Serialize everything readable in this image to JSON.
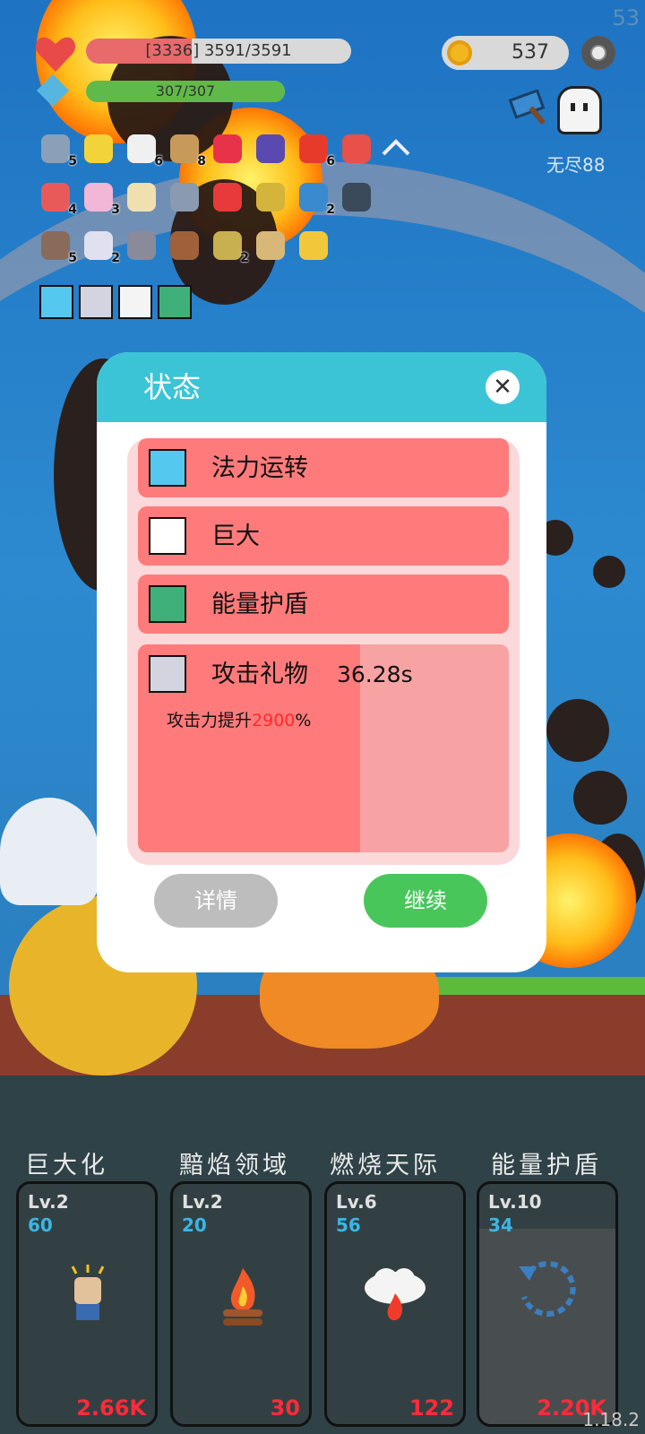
{
  "hud": {
    "fps": "53",
    "hp_text": "[3336] 3591/3591",
    "hp_fraction": 0.4,
    "mana_text": "307/307",
    "mana_fraction": 1.0,
    "gold": "537",
    "endless_label": "无尽88",
    "version": "1.18.2"
  },
  "inventory": {
    "row1": [
      {
        "icon": "sword-icon",
        "count": "5"
      },
      {
        "icon": "lightbulb-icon",
        "count": ""
      },
      {
        "icon": "flower-icon",
        "count": "6"
      },
      {
        "icon": "book-icon",
        "count": "8"
      },
      {
        "icon": "gem-icon",
        "count": ""
      },
      {
        "icon": "wizard-hat-icon",
        "count": ""
      },
      {
        "icon": "apple-icon",
        "count": "6"
      },
      {
        "icon": "gift-icon",
        "count": ""
      }
    ],
    "row2": [
      {
        "icon": "watermelon-icon",
        "count": "4"
      },
      {
        "icon": "ice-cream-icon",
        "count": "3"
      },
      {
        "icon": "treasure-map-icon",
        "count": ""
      },
      {
        "icon": "shuriken-icon",
        "count": ""
      },
      {
        "icon": "strawberry-icon",
        "count": ""
      },
      {
        "icon": "egg-icon",
        "count": ""
      },
      {
        "icon": "dagger-icon",
        "count": "2"
      },
      {
        "icon": "skull-book-icon",
        "count": ""
      }
    ],
    "row3": [
      {
        "icon": "target-icon",
        "count": "5"
      },
      {
        "icon": "envelope-icon",
        "count": "2"
      },
      {
        "icon": "gravestone-icon",
        "count": ""
      },
      {
        "icon": "meat-icon",
        "count": ""
      },
      {
        "icon": "battery-icon",
        "count": "2"
      },
      {
        "icon": "scroll-icon",
        "count": ""
      },
      {
        "icon": "cheese-icon",
        "count": ""
      }
    ],
    "buffs": [
      "mana-flow-icon",
      "attack-gift-icon",
      "giant-icon",
      "energy-shield-icon"
    ]
  },
  "dialog": {
    "title": "状态",
    "close": "✕",
    "statuses": [
      {
        "icon": "mana-flow-icon",
        "name": "法力运转"
      },
      {
        "icon": "giant-icon",
        "name": "巨大"
      },
      {
        "icon": "energy-shield-icon",
        "name": "能量护盾"
      }
    ],
    "active": {
      "icon": "attack-gift-icon",
      "name": "攻击礼物",
      "timer": "36.28s",
      "desc_prefix": "攻击力提升",
      "desc_value": "2900",
      "desc_suffix": "%",
      "remaining_fraction": 0.6
    },
    "detail_button": "详情",
    "continue_button": "继续"
  },
  "skills": [
    {
      "title": "巨大化",
      "level": "Lv.2",
      "cost": "60",
      "price": "2.66K",
      "icon": "fist-icon"
    },
    {
      "title": "黯焰领域",
      "level": "Lv.2",
      "cost": "20",
      "price": "30",
      "icon": "campfire-icon"
    },
    {
      "title": "燃烧天际",
      "level": "Lv.6",
      "cost": "56",
      "price": "122",
      "icon": "fire-cloud-icon"
    },
    {
      "title": "能量护盾",
      "level": "Lv.10",
      "cost": "34",
      "price": "2.20K",
      "icon": "cooldown-arrow-icon"
    }
  ]
}
